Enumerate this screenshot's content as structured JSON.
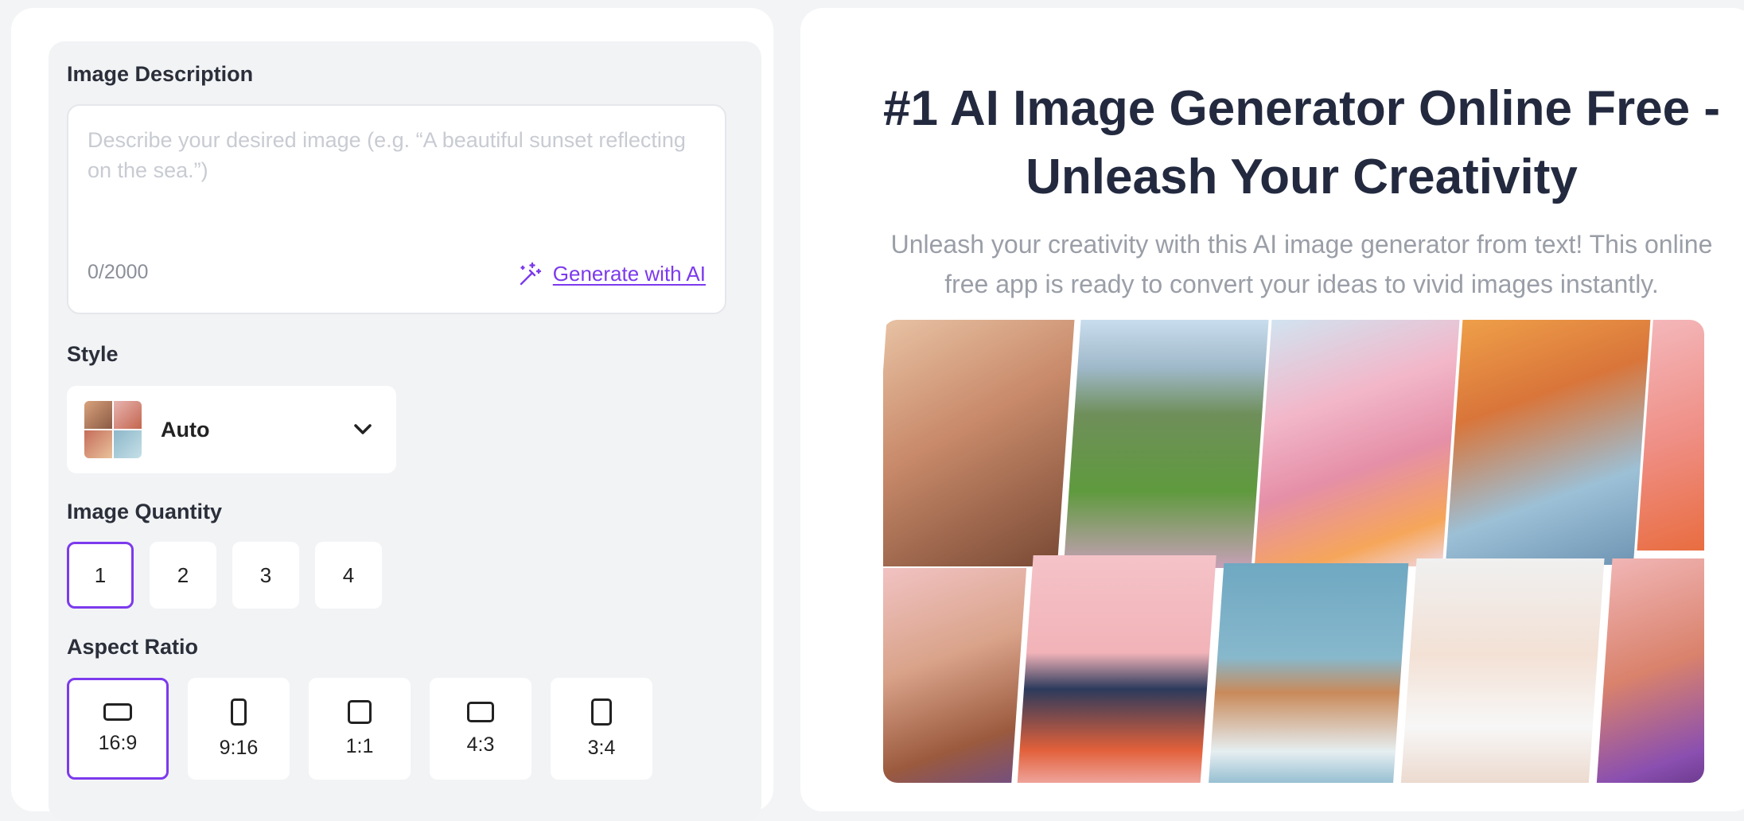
{
  "form": {
    "description": {
      "label": "Image Description",
      "placeholder": "Describe your desired image (e.g. “A beautiful sunset reflecting on the sea.”)",
      "char_count": "0/2000",
      "generate_label": "Generate with AI"
    },
    "style": {
      "label": "Style",
      "value": "Auto"
    },
    "quantity": {
      "label": "Image Quantity",
      "options": [
        "1",
        "2",
        "3",
        "4"
      ],
      "selected": "1"
    },
    "aspect_ratio": {
      "label": "Aspect Ratio",
      "options": [
        "16:9",
        "9:16",
        "1:1",
        "4:3",
        "3:4"
      ],
      "selected": "16:9"
    }
  },
  "hero": {
    "title": "#1 AI Image Generator Online Free - Unleash Your Creativity",
    "subtitle": "Unleash your creativity with this AI image generator from text! This online free app is ready to convert your ideas to vivid images instantly."
  },
  "colors": {
    "accent": "#7c3aed",
    "title": "#232a3f",
    "muted": "#9a9ea7"
  }
}
